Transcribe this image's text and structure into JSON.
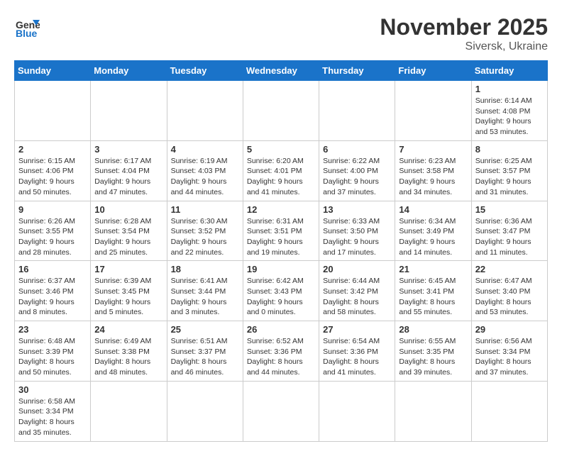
{
  "header": {
    "logo_general": "General",
    "logo_blue": "Blue",
    "month_year": "November 2025",
    "location": "Siversk, Ukraine"
  },
  "weekdays": [
    "Sunday",
    "Monday",
    "Tuesday",
    "Wednesday",
    "Thursday",
    "Friday",
    "Saturday"
  ],
  "weeks": [
    [
      {
        "day": "",
        "info": ""
      },
      {
        "day": "",
        "info": ""
      },
      {
        "day": "",
        "info": ""
      },
      {
        "day": "",
        "info": ""
      },
      {
        "day": "",
        "info": ""
      },
      {
        "day": "",
        "info": ""
      },
      {
        "day": "1",
        "info": "Sunrise: 6:14 AM\nSunset: 4:08 PM\nDaylight: 9 hours and 53 minutes."
      }
    ],
    [
      {
        "day": "2",
        "info": "Sunrise: 6:15 AM\nSunset: 4:06 PM\nDaylight: 9 hours and 50 minutes."
      },
      {
        "day": "3",
        "info": "Sunrise: 6:17 AM\nSunset: 4:04 PM\nDaylight: 9 hours and 47 minutes."
      },
      {
        "day": "4",
        "info": "Sunrise: 6:19 AM\nSunset: 4:03 PM\nDaylight: 9 hours and 44 minutes."
      },
      {
        "day": "5",
        "info": "Sunrise: 6:20 AM\nSunset: 4:01 PM\nDaylight: 9 hours and 41 minutes."
      },
      {
        "day": "6",
        "info": "Sunrise: 6:22 AM\nSunset: 4:00 PM\nDaylight: 9 hours and 37 minutes."
      },
      {
        "day": "7",
        "info": "Sunrise: 6:23 AM\nSunset: 3:58 PM\nDaylight: 9 hours and 34 minutes."
      },
      {
        "day": "8",
        "info": "Sunrise: 6:25 AM\nSunset: 3:57 PM\nDaylight: 9 hours and 31 minutes."
      }
    ],
    [
      {
        "day": "9",
        "info": "Sunrise: 6:26 AM\nSunset: 3:55 PM\nDaylight: 9 hours and 28 minutes."
      },
      {
        "day": "10",
        "info": "Sunrise: 6:28 AM\nSunset: 3:54 PM\nDaylight: 9 hours and 25 minutes."
      },
      {
        "day": "11",
        "info": "Sunrise: 6:30 AM\nSunset: 3:52 PM\nDaylight: 9 hours and 22 minutes."
      },
      {
        "day": "12",
        "info": "Sunrise: 6:31 AM\nSunset: 3:51 PM\nDaylight: 9 hours and 19 minutes."
      },
      {
        "day": "13",
        "info": "Sunrise: 6:33 AM\nSunset: 3:50 PM\nDaylight: 9 hours and 17 minutes."
      },
      {
        "day": "14",
        "info": "Sunrise: 6:34 AM\nSunset: 3:49 PM\nDaylight: 9 hours and 14 minutes."
      },
      {
        "day": "15",
        "info": "Sunrise: 6:36 AM\nSunset: 3:47 PM\nDaylight: 9 hours and 11 minutes."
      }
    ],
    [
      {
        "day": "16",
        "info": "Sunrise: 6:37 AM\nSunset: 3:46 PM\nDaylight: 9 hours and 8 minutes."
      },
      {
        "day": "17",
        "info": "Sunrise: 6:39 AM\nSunset: 3:45 PM\nDaylight: 9 hours and 5 minutes."
      },
      {
        "day": "18",
        "info": "Sunrise: 6:41 AM\nSunset: 3:44 PM\nDaylight: 9 hours and 3 minutes."
      },
      {
        "day": "19",
        "info": "Sunrise: 6:42 AM\nSunset: 3:43 PM\nDaylight: 9 hours and 0 minutes."
      },
      {
        "day": "20",
        "info": "Sunrise: 6:44 AM\nSunset: 3:42 PM\nDaylight: 8 hours and 58 minutes."
      },
      {
        "day": "21",
        "info": "Sunrise: 6:45 AM\nSunset: 3:41 PM\nDaylight: 8 hours and 55 minutes."
      },
      {
        "day": "22",
        "info": "Sunrise: 6:47 AM\nSunset: 3:40 PM\nDaylight: 8 hours and 53 minutes."
      }
    ],
    [
      {
        "day": "23",
        "info": "Sunrise: 6:48 AM\nSunset: 3:39 PM\nDaylight: 8 hours and 50 minutes."
      },
      {
        "day": "24",
        "info": "Sunrise: 6:49 AM\nSunset: 3:38 PM\nDaylight: 8 hours and 48 minutes."
      },
      {
        "day": "25",
        "info": "Sunrise: 6:51 AM\nSunset: 3:37 PM\nDaylight: 8 hours and 46 minutes."
      },
      {
        "day": "26",
        "info": "Sunrise: 6:52 AM\nSunset: 3:36 PM\nDaylight: 8 hours and 44 minutes."
      },
      {
        "day": "27",
        "info": "Sunrise: 6:54 AM\nSunset: 3:36 PM\nDaylight: 8 hours and 41 minutes."
      },
      {
        "day": "28",
        "info": "Sunrise: 6:55 AM\nSunset: 3:35 PM\nDaylight: 8 hours and 39 minutes."
      },
      {
        "day": "29",
        "info": "Sunrise: 6:56 AM\nSunset: 3:34 PM\nDaylight: 8 hours and 37 minutes."
      }
    ],
    [
      {
        "day": "30",
        "info": "Sunrise: 6:58 AM\nSunset: 3:34 PM\nDaylight: 8 hours and 35 minutes."
      },
      {
        "day": "",
        "info": ""
      },
      {
        "day": "",
        "info": ""
      },
      {
        "day": "",
        "info": ""
      },
      {
        "day": "",
        "info": ""
      },
      {
        "day": "",
        "info": ""
      },
      {
        "day": "",
        "info": ""
      }
    ]
  ]
}
